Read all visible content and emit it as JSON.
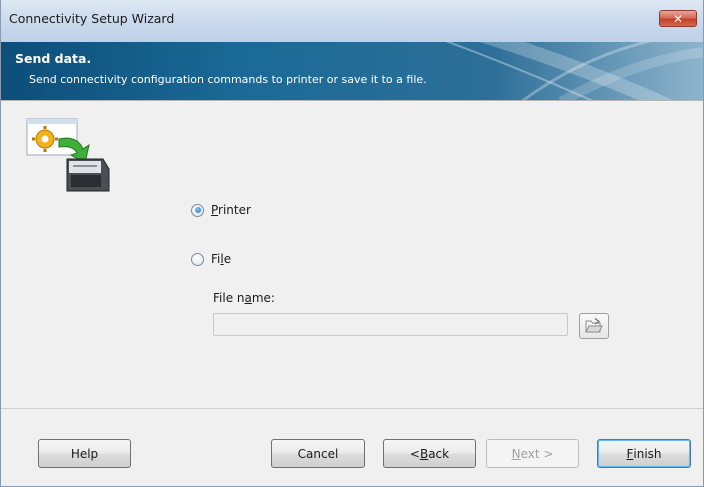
{
  "window": {
    "title": "Connectivity Setup Wizard",
    "close_glyph": "✕"
  },
  "banner": {
    "title": "Send data.",
    "subtitle": "Send connectivity configuration commands to printer or save it to a file."
  },
  "options": {
    "printer": {
      "mnemonic": "P",
      "rest": "rinter",
      "selected": true
    },
    "file": {
      "pre": "Fi",
      "mnemonic": "l",
      "post": "e",
      "selected": false
    }
  },
  "file_name": {
    "label_pre": "File n",
    "label_mnemonic": "a",
    "label_post": "me:",
    "value": "",
    "enabled": false
  },
  "buttons": {
    "help": "Help",
    "cancel": "Cancel",
    "back": {
      "pre": "< ",
      "mnemonic": "B",
      "post": "ack"
    },
    "next": {
      "mnemonic": "N",
      "post": "ext >",
      "enabled": false
    },
    "finish": {
      "mnemonic": "F",
      "post": "inish"
    }
  },
  "icons": {
    "close": "close-icon",
    "wizard": "printer-settings-icon",
    "browse": "folder-open-icon"
  },
  "colors": {
    "banner": "#1b6a97",
    "accent": "#3c7fb1",
    "close": "#c4412a"
  }
}
